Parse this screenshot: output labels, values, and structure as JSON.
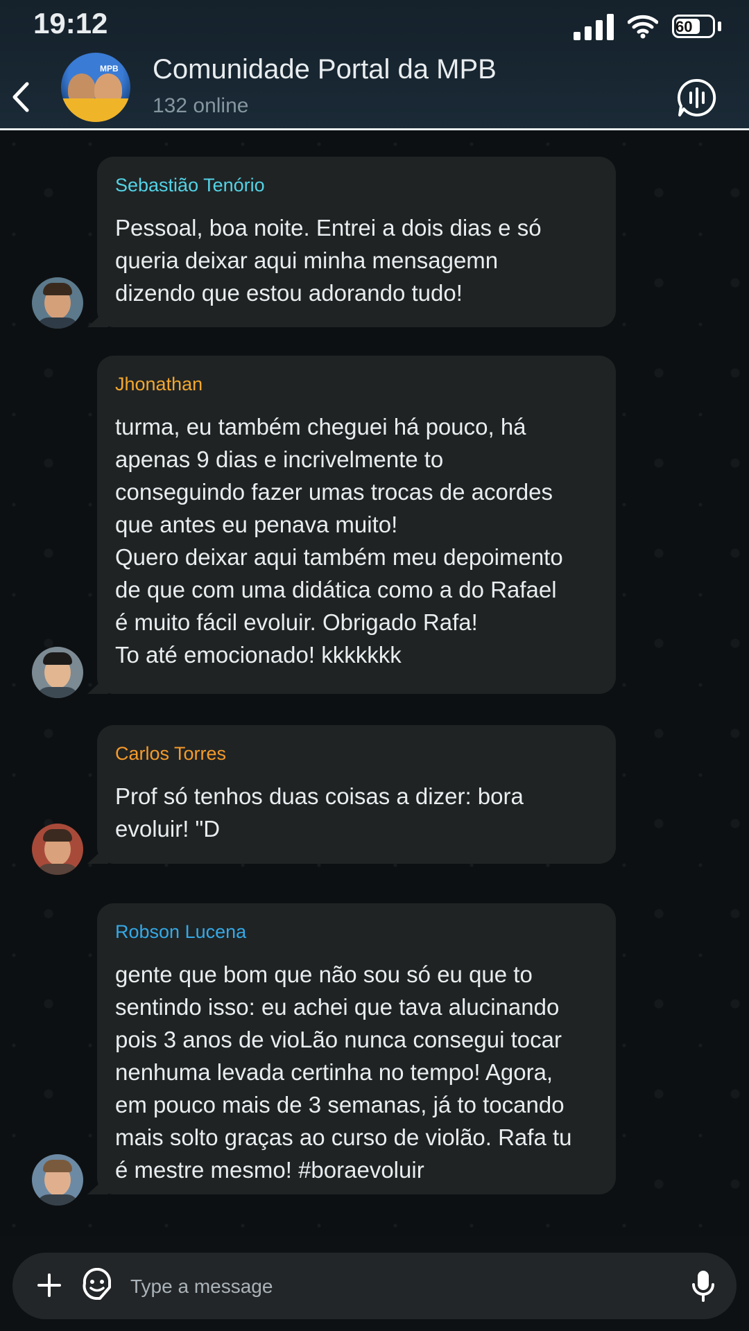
{
  "status_bar": {
    "time": "19:12",
    "battery": "60"
  },
  "header": {
    "title": "Comunidade Portal da MPB",
    "subtitle": "132 online",
    "avatar_icon": "group-avatar",
    "back_icon": "chevron-left-icon",
    "action_icon": "voice-chat-icon"
  },
  "messages": [
    {
      "sender": "Sebastião Tenório",
      "sender_color": "#53d3e6",
      "text": "Pessoal, boa noite. Entrei a dois dias e só\nqueria deixar aqui minha mensagemn\ndizendo que estou adorando tudo!"
    },
    {
      "sender": "Jhonathan",
      "sender_color": "#f2a72e",
      "text": "turma, eu também cheguei há pouco, há\napenas 9 dias e incrivelmente to\nconseguindo fazer umas trocas de acordes\nque antes eu penava muito!\nQuero deixar aqui também meu depoimento\nde que com uma didática como a do Rafael\né muito fácil evoluir. Obrigado Rafa!\nTo até emocionado! kkkkkkk"
    },
    {
      "sender": "Carlos Torres",
      "sender_color": "#f59b2a",
      "text": "Prof só tenhos duas coisas a dizer: bora\nevoluir! \"D"
    },
    {
      "sender": "Robson Lucena",
      "sender_color": "#34a9e6",
      "text": "gente que bom que não sou só eu que to\nsentindo isso: eu achei que tava alucinando\npois 3 anos de vioLão nunca consegui tocar\nnenhuma levada certinha no tempo! Agora,\nem pouco mais de 3 semanas, já to tocando\nmais solto graças ao curso de violão. Rafa tu\né mestre mesmo! #boraevoluir"
    }
  ],
  "input": {
    "placeholder": "Type a message",
    "add_icon": "plus-icon",
    "sticker_icon": "sticker-icon",
    "mic_icon": "microphone-icon"
  }
}
